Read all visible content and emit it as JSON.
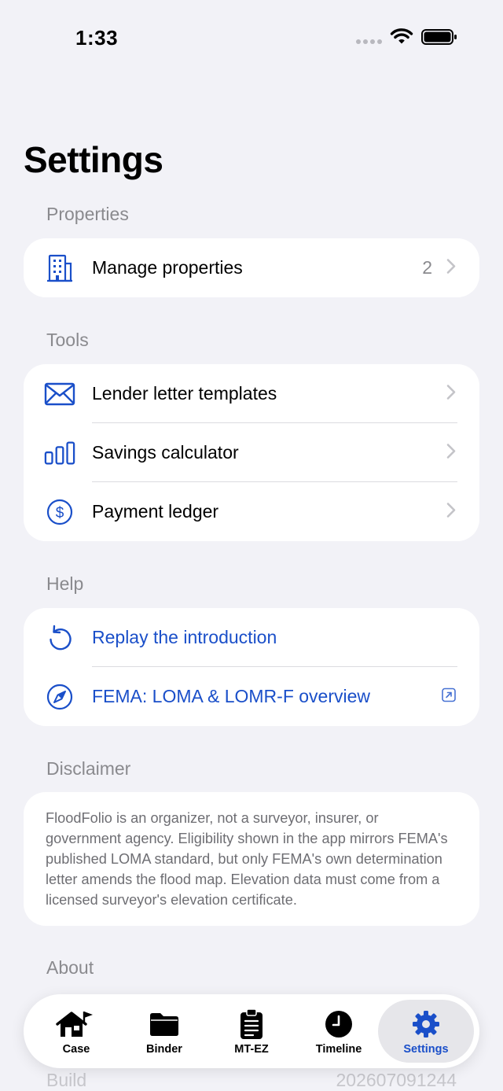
{
  "status_bar": {
    "time": "1:33"
  },
  "page": {
    "title": "Settings"
  },
  "sections": {
    "properties": {
      "header": "Properties",
      "items": [
        {
          "label": "Manage properties",
          "count": "2",
          "icon": "building-icon"
        }
      ]
    },
    "tools": {
      "header": "Tools",
      "items": [
        {
          "label": "Lender letter templates",
          "icon": "envelope-icon"
        },
        {
          "label": "Savings calculator",
          "icon": "chart-bars-icon"
        },
        {
          "label": "Payment ledger",
          "icon": "dollar-circle-icon"
        }
      ]
    },
    "help": {
      "header": "Help",
      "items": [
        {
          "label": "Replay the introduction",
          "icon": "replay-icon"
        },
        {
          "label": "FEMA: LOMA & LOMR-F overview",
          "icon": "compass-icon"
        }
      ]
    },
    "disclaimer": {
      "header": "Disclaimer",
      "text": "FloodFolio is an organizer, not a surveyor, insurer, or government agency. Eligibility shown in the app mirrors FEMA's published LOMA standard, but only FEMA's own determination letter amends the flood map. Elevation data must come from a licensed surveyor's elevation certificate."
    },
    "about": {
      "header": "About",
      "build_label": "Build",
      "build_value": "202607091244"
    }
  },
  "tab_bar": {
    "active": "settings",
    "tabs": [
      {
        "id": "case",
        "label": "Case",
        "icon": "house-flag-icon"
      },
      {
        "id": "binder",
        "label": "Binder",
        "icon": "folder-icon"
      },
      {
        "id": "mt-ez",
        "label": "MT-EZ",
        "icon": "clipboard-icon"
      },
      {
        "id": "timeline",
        "label": "Timeline",
        "icon": "clock-icon"
      },
      {
        "id": "settings",
        "label": "Settings",
        "icon": "gear-icon"
      }
    ]
  },
  "colors": {
    "accent": "#1A4FC9",
    "background": "#F2F2F7",
    "card": "#FFFFFF",
    "secondary_text": "#8A8A8E"
  }
}
